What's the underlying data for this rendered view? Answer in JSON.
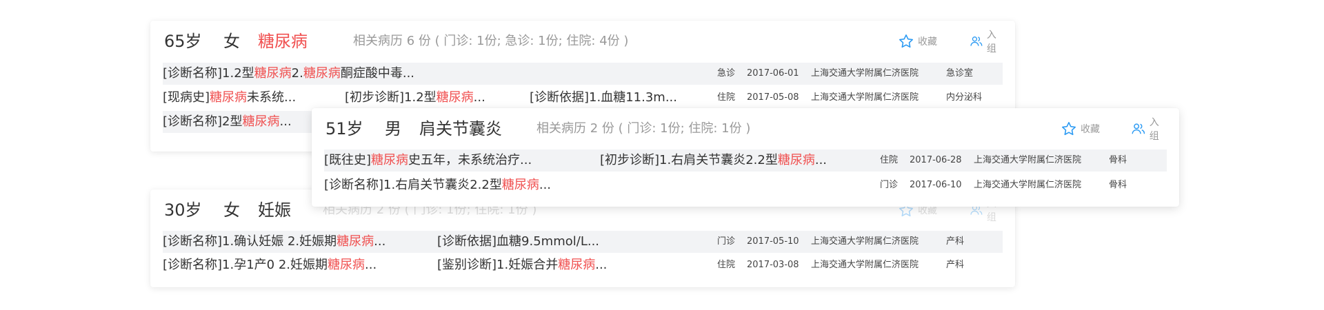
{
  "ui": {
    "collect_label": "收藏",
    "group_label": "入组",
    "accent": "#2b9af3",
    "highlight": "#f05050"
  },
  "card1": {
    "age": "65岁",
    "sex": "女",
    "diagnosis": "糖尿病",
    "history": "相关病历 6 份 ( 门诊: 1份;  急诊: 1份;  住院: 4份 )",
    "rows": [
      {
        "segments": [
          [
            {
              "t": "[诊断名称]1.2型"
            },
            {
              "t": "糖尿病",
              "h": true
            },
            {
              "t": "2."
            },
            {
              "t": "糖尿病",
              "h": true
            },
            {
              "t": "酮症酸中毒..."
            }
          ]
        ],
        "type": "急诊",
        "date": "2017-06-01",
        "hospital": "上海交通大学附属仁济医院",
        "dept": "急诊室"
      },
      {
        "segments": [
          [
            {
              "t": "[现病史]"
            },
            {
              "t": "糖尿病",
              "h": true
            },
            {
              "t": "未系统..."
            }
          ],
          [
            {
              "t": "[初步诊断]1.2型"
            },
            {
              "t": "糖尿病",
              "h": true
            },
            {
              "t": "..."
            }
          ],
          [
            {
              "t": "[诊断依据]1.血糖11.3m..."
            }
          ]
        ],
        "type": "住院",
        "date": "2017-05-08",
        "hospital": "上海交通大学附属仁济医院",
        "dept": "内分泌科"
      },
      {
        "segments": [
          [
            {
              "t": "[诊断名称]2型"
            },
            {
              "t": "糖尿病",
              "h": true
            },
            {
              "t": "..."
            }
          ]
        ],
        "type": "",
        "date": "",
        "hospital": "",
        "dept": ""
      }
    ]
  },
  "card2": {
    "age": "51岁",
    "sex": "男",
    "diagnosis": "肩关节囊炎",
    "history": "相关病历 2 份 ( 门诊: 1份;  住院: 1份 )",
    "rows": [
      {
        "segments": [
          [
            {
              "t": "[既往史]"
            },
            {
              "t": "糖尿病",
              "h": true
            },
            {
              "t": "史五年，未系统治疗..."
            }
          ],
          [
            {
              "t": "[初步诊断]1.右肩关节囊炎2.2型"
            },
            {
              "t": "糖尿病",
              "h": true
            },
            {
              "t": "..."
            }
          ]
        ],
        "type": "住院",
        "date": "2017-06-28",
        "hospital": "上海交通大学附属仁济医院",
        "dept": "骨科"
      },
      {
        "segments": [
          [
            {
              "t": "[诊断名称]1.右肩关节囊炎2.2型"
            },
            {
              "t": "糖尿病",
              "h": true
            },
            {
              "t": "..."
            }
          ]
        ],
        "type": "门诊",
        "date": "2017-06-10",
        "hospital": "上海交通大学附属仁济医院",
        "dept": "骨科"
      }
    ]
  },
  "card3": {
    "age": "30岁",
    "sex": "女",
    "diagnosis": "妊娠",
    "history": "相关病历 2 份 ( 门诊: 1份;  住院: 1份 )",
    "rows": [
      {
        "segments": [
          [
            {
              "t": "[诊断名称]1.确认妊娠 2.妊娠期"
            },
            {
              "t": "糖尿病",
              "h": true
            },
            {
              "t": "..."
            }
          ],
          [
            {
              "t": "[诊断依据]血糖9.5mmol/L..."
            }
          ]
        ],
        "type": "门诊",
        "date": "2017-05-10",
        "hospital": "上海交通大学附属仁济医院",
        "dept": "产科"
      },
      {
        "segments": [
          [
            {
              "t": "[诊断名称]1.孕1产0 2.妊娠期"
            },
            {
              "t": "糖尿病",
              "h": true
            },
            {
              "t": "..."
            }
          ],
          [
            {
              "t": "[鉴别诊断]1.妊娠合并"
            },
            {
              "t": "糖尿病",
              "h": true
            },
            {
              "t": "..."
            }
          ]
        ],
        "type": "住院",
        "date": "2017-03-08",
        "hospital": "上海交通大学附属仁济医院",
        "dept": "产科"
      }
    ]
  }
}
